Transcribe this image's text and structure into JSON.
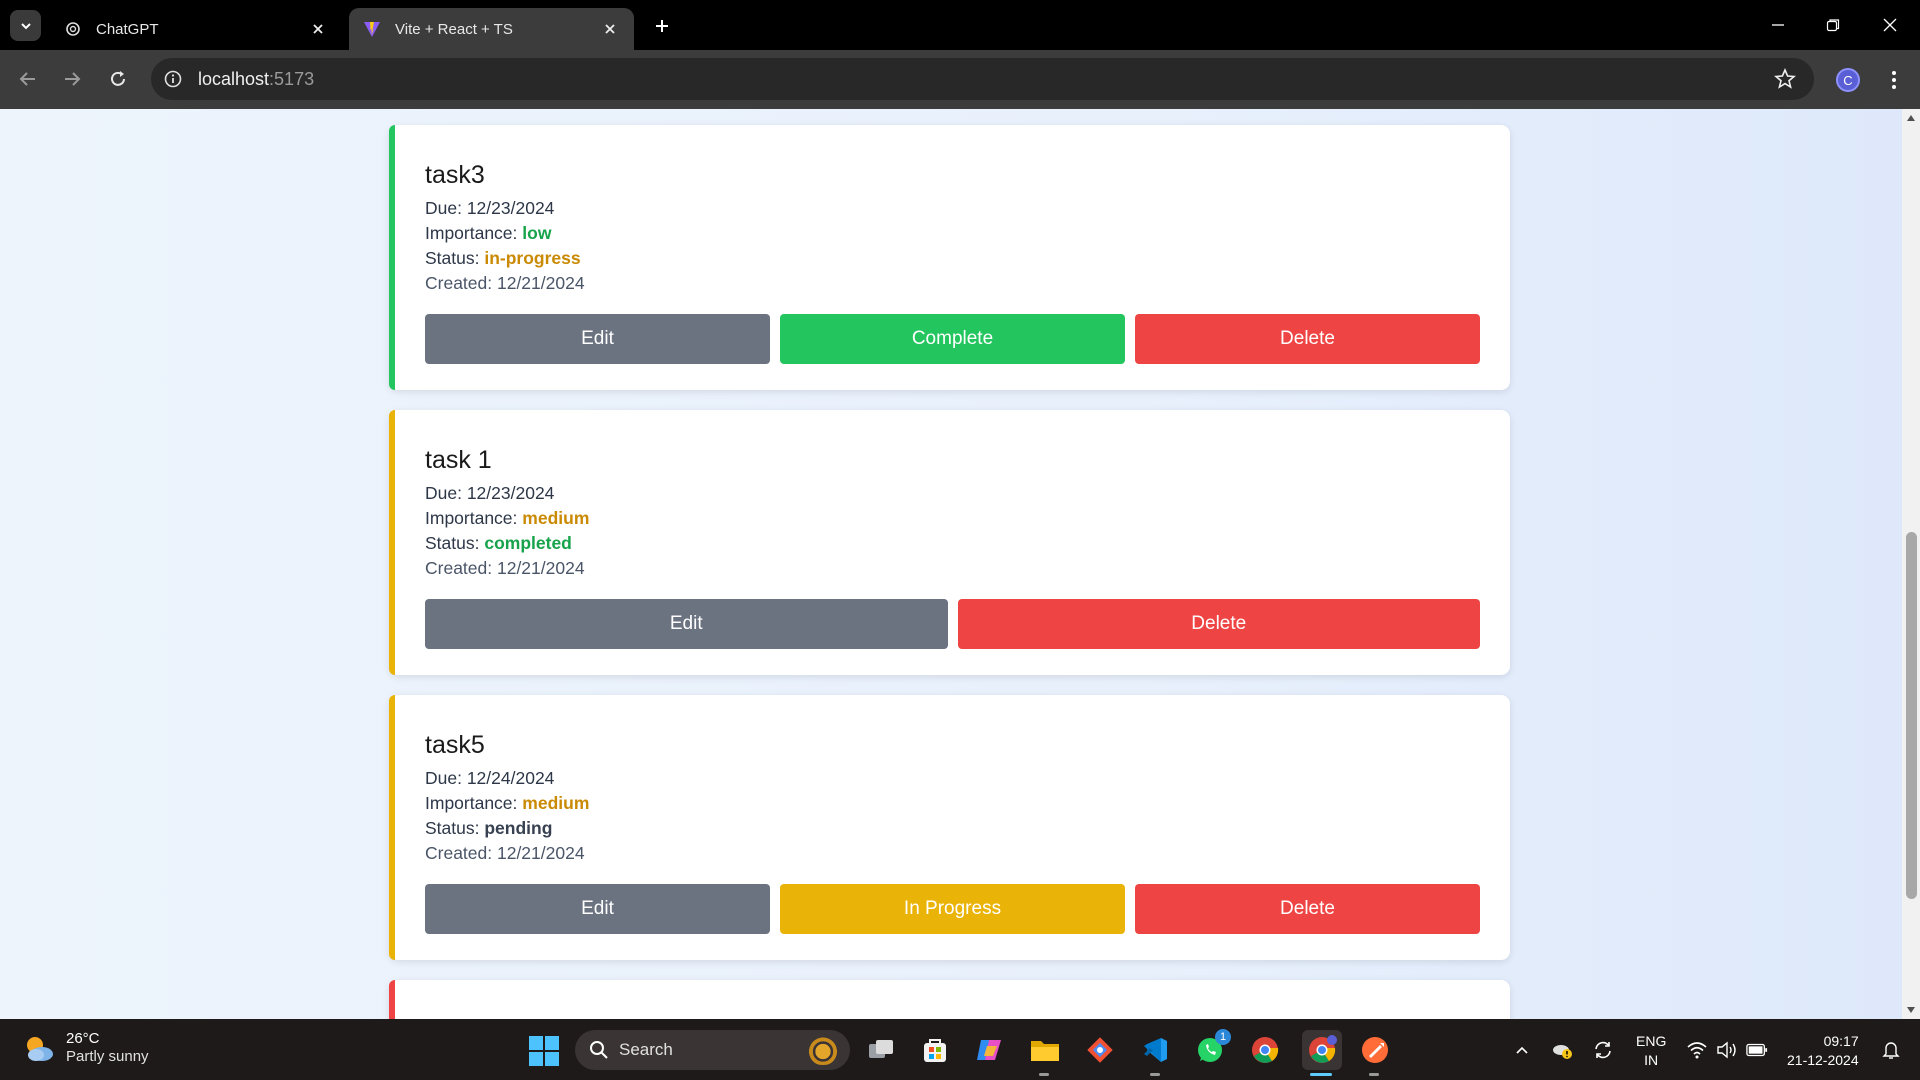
{
  "browser": {
    "tabs": [
      {
        "title": "ChatGPT",
        "active": false
      },
      {
        "title": "Vite + React + TS",
        "active": true
      }
    ],
    "url_host": "localhost",
    "url_port": ":5173",
    "profile_initial": "C"
  },
  "tasks": [
    {
      "title": "task3",
      "due_label": "Due: ",
      "due": "12/23/2024",
      "importance_label": "Importance: ",
      "importance": "low",
      "status_label": "Status: ",
      "status": "in-progress",
      "created_label": "Created: ",
      "created": "12/21/2024",
      "accent": "#22c55e",
      "importance_color": "#16a34a",
      "status_color": "#ca8a04",
      "buttons": [
        "Edit",
        "Complete",
        "Delete"
      ]
    },
    {
      "title": "task 1",
      "due_label": "Due: ",
      "due": "12/23/2024",
      "importance_label": "Importance: ",
      "importance": "medium",
      "status_label": "Status: ",
      "status": "completed",
      "created_label": "Created: ",
      "created": "12/21/2024",
      "accent": "#eab308",
      "importance_color": "#ca8a04",
      "status_color": "#16a34a",
      "buttons": [
        "Edit",
        "Delete"
      ]
    },
    {
      "title": "task5",
      "due_label": "Due: ",
      "due": "12/24/2024",
      "importance_label": "Importance: ",
      "importance": "medium",
      "status_label": "Status: ",
      "status": "pending",
      "created_label": "Created: ",
      "created": "12/21/2024",
      "accent": "#eab308",
      "importance_color": "#ca8a04",
      "status_color": "#374151",
      "buttons": [
        "Edit",
        "In Progress",
        "Delete"
      ]
    }
  ],
  "partial_card_accent": "#ef4444",
  "taskbar": {
    "weather_temp": "26°C",
    "weather_desc": "Partly sunny",
    "search_label": "Search",
    "whatsapp_badge": "1",
    "lang_line1": "ENG",
    "lang_line2": "IN",
    "time": "09:17",
    "date": "21-12-2024"
  }
}
